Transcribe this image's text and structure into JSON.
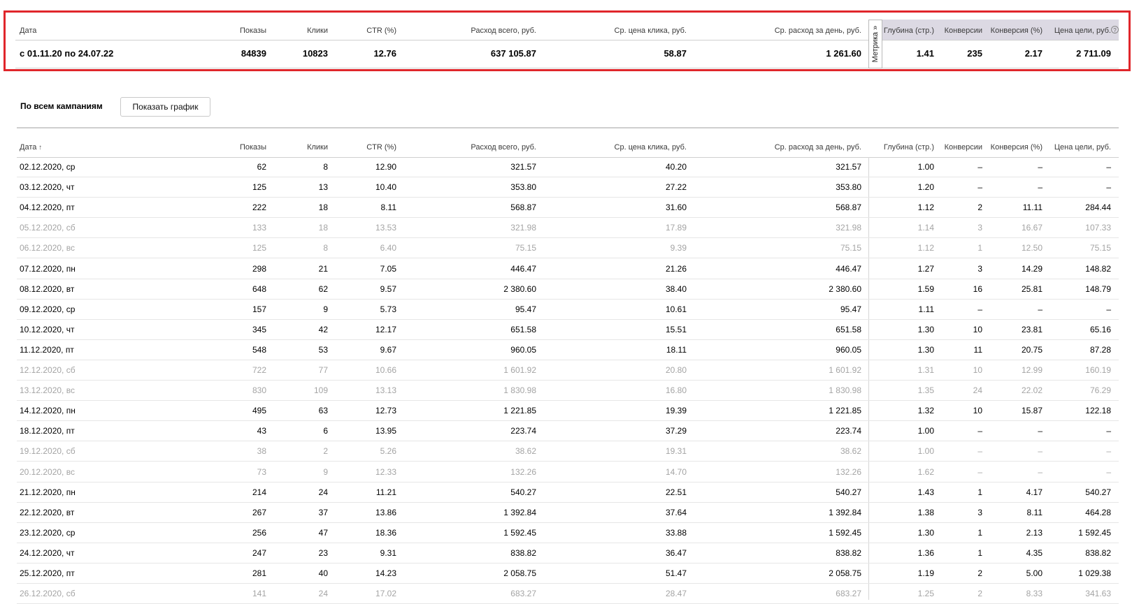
{
  "summary": {
    "headers": [
      "Дата",
      "Показы",
      "Клики",
      "CTR (%)",
      "Расход всего, руб.",
      "Ср. цена клика, руб.",
      "Ср. расход за день, руб.",
      "Глубина (стр.)",
      "Конверсии",
      "Конверсия (%)",
      "Цена цели, руб."
    ],
    "values": [
      "с 01.11.20 по 24.07.22",
      "84839",
      "10823",
      "12.76",
      "637 105.87",
      "58.87",
      "1 261.60",
      "1.41",
      "235",
      "2.17",
      "2 711.09"
    ],
    "metrika_tab": "Метрика »",
    "info_icon": "?"
  },
  "section": {
    "title": "По всем кампаниям",
    "show_graph_button": "Показать график"
  },
  "table": {
    "headers": [
      "Дата",
      "Показы",
      "Клики",
      "CTR (%)",
      "Расход всего, руб.",
      "Ср. цена клика, руб.",
      "Ср. расход за день, руб.",
      "Глубина (стр.)",
      "Конверсии",
      "Конверсия (%)",
      "Цена цели, руб."
    ],
    "sort_indicator": "↑",
    "rows": [
      {
        "weekend": false,
        "cells": [
          "02.12.2020, ср",
          "62",
          "8",
          "12.90",
          "321.57",
          "40.20",
          "321.57",
          "1.00",
          "–",
          "–",
          "–"
        ]
      },
      {
        "weekend": false,
        "cells": [
          "03.12.2020, чт",
          "125",
          "13",
          "10.40",
          "353.80",
          "27.22",
          "353.80",
          "1.20",
          "–",
          "–",
          "–"
        ]
      },
      {
        "weekend": false,
        "cells": [
          "04.12.2020, пт",
          "222",
          "18",
          "8.11",
          "568.87",
          "31.60",
          "568.87",
          "1.12",
          "2",
          "11.11",
          "284.44"
        ]
      },
      {
        "weekend": true,
        "cells": [
          "05.12.2020, сб",
          "133",
          "18",
          "13.53",
          "321.98",
          "17.89",
          "321.98",
          "1.14",
          "3",
          "16.67",
          "107.33"
        ]
      },
      {
        "weekend": true,
        "cells": [
          "06.12.2020, вс",
          "125",
          "8",
          "6.40",
          "75.15",
          "9.39",
          "75.15",
          "1.12",
          "1",
          "12.50",
          "75.15"
        ]
      },
      {
        "weekend": false,
        "cells": [
          "07.12.2020, пн",
          "298",
          "21",
          "7.05",
          "446.47",
          "21.26",
          "446.47",
          "1.27",
          "3",
          "14.29",
          "148.82"
        ]
      },
      {
        "weekend": false,
        "cells": [
          "08.12.2020, вт",
          "648",
          "62",
          "9.57",
          "2 380.60",
          "38.40",
          "2 380.60",
          "1.59",
          "16",
          "25.81",
          "148.79"
        ]
      },
      {
        "weekend": false,
        "cells": [
          "09.12.2020, ср",
          "157",
          "9",
          "5.73",
          "95.47",
          "10.61",
          "95.47",
          "1.11",
          "–",
          "–",
          "–"
        ]
      },
      {
        "weekend": false,
        "cells": [
          "10.12.2020, чт",
          "345",
          "42",
          "12.17",
          "651.58",
          "15.51",
          "651.58",
          "1.30",
          "10",
          "23.81",
          "65.16"
        ]
      },
      {
        "weekend": false,
        "cells": [
          "11.12.2020, пт",
          "548",
          "53",
          "9.67",
          "960.05",
          "18.11",
          "960.05",
          "1.30",
          "11",
          "20.75",
          "87.28"
        ]
      },
      {
        "weekend": true,
        "cells": [
          "12.12.2020, сб",
          "722",
          "77",
          "10.66",
          "1 601.92",
          "20.80",
          "1 601.92",
          "1.31",
          "10",
          "12.99",
          "160.19"
        ]
      },
      {
        "weekend": true,
        "cells": [
          "13.12.2020, вс",
          "830",
          "109",
          "13.13",
          "1 830.98",
          "16.80",
          "1 830.98",
          "1.35",
          "24",
          "22.02",
          "76.29"
        ]
      },
      {
        "weekend": false,
        "cells": [
          "14.12.2020, пн",
          "495",
          "63",
          "12.73",
          "1 221.85",
          "19.39",
          "1 221.85",
          "1.32",
          "10",
          "15.87",
          "122.18"
        ]
      },
      {
        "weekend": false,
        "cells": [
          "18.12.2020, пт",
          "43",
          "6",
          "13.95",
          "223.74",
          "37.29",
          "223.74",
          "1.00",
          "–",
          "–",
          "–"
        ]
      },
      {
        "weekend": true,
        "cells": [
          "19.12.2020, сб",
          "38",
          "2",
          "5.26",
          "38.62",
          "19.31",
          "38.62",
          "1.00",
          "–",
          "–",
          "–"
        ]
      },
      {
        "weekend": true,
        "cells": [
          "20.12.2020, вс",
          "73",
          "9",
          "12.33",
          "132.26",
          "14.70",
          "132.26",
          "1.62",
          "–",
          "–",
          "–"
        ]
      },
      {
        "weekend": false,
        "cells": [
          "21.12.2020, пн",
          "214",
          "24",
          "11.21",
          "540.27",
          "22.51",
          "540.27",
          "1.43",
          "1",
          "4.17",
          "540.27"
        ]
      },
      {
        "weekend": false,
        "cells": [
          "22.12.2020, вт",
          "267",
          "37",
          "13.86",
          "1 392.84",
          "37.64",
          "1 392.84",
          "1.38",
          "3",
          "8.11",
          "464.28"
        ]
      },
      {
        "weekend": false,
        "cells": [
          "23.12.2020, ср",
          "256",
          "47",
          "18.36",
          "1 592.45",
          "33.88",
          "1 592.45",
          "1.30",
          "1",
          "2.13",
          "1 592.45"
        ]
      },
      {
        "weekend": false,
        "cells": [
          "24.12.2020, чт",
          "247",
          "23",
          "9.31",
          "838.82",
          "36.47",
          "838.82",
          "1.36",
          "1",
          "4.35",
          "838.82"
        ]
      },
      {
        "weekend": false,
        "cells": [
          "25.12.2020, пт",
          "281",
          "40",
          "14.23",
          "2 058.75",
          "51.47",
          "2 058.75",
          "1.19",
          "2",
          "5.00",
          "1 029.38"
        ]
      },
      {
        "weekend": true,
        "cells": [
          "26.12.2020, сб",
          "141",
          "24",
          "17.02",
          "683.27",
          "28.47",
          "683.27",
          "1.25",
          "2",
          "8.33",
          "341.63"
        ]
      }
    ]
  },
  "colors": {
    "highlight_border": "#e0262b",
    "metrika_band": "#dcd9e3",
    "weekend_text": "#a4a4a4"
  }
}
